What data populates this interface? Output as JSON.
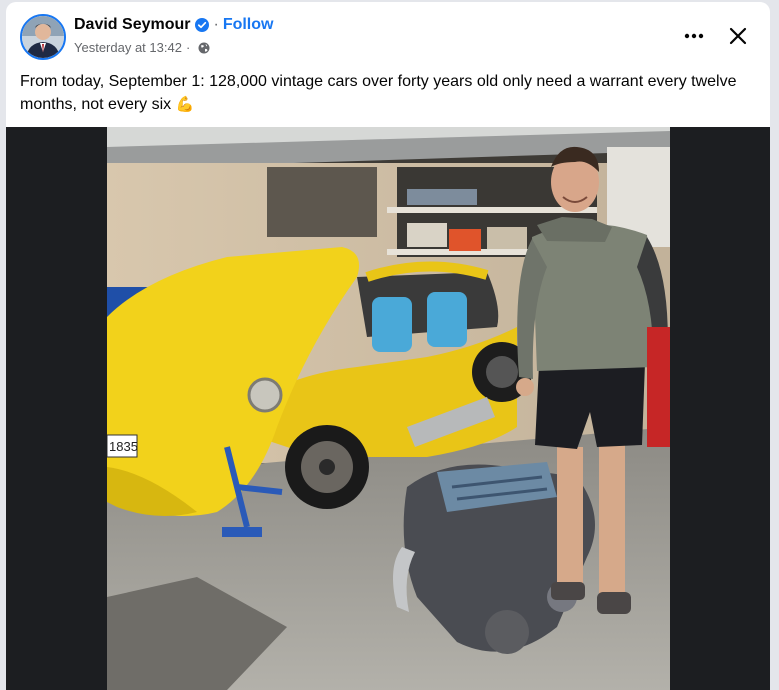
{
  "post": {
    "author": "David Seymour",
    "follow_label": "Follow",
    "separator": "·",
    "timestamp": "Yesterday at 13:42",
    "audience_icon": "globe-icon",
    "text": "From today, September 1: 128,000 vintage cars over forty years old only need a warrant every twelve months, not every six",
    "emoji": "💪",
    "plate_text": "1835"
  },
  "colors": {
    "accent": "#1877f2",
    "car_yellow": "#f2d21b",
    "media_background": "#1c1e21"
  }
}
